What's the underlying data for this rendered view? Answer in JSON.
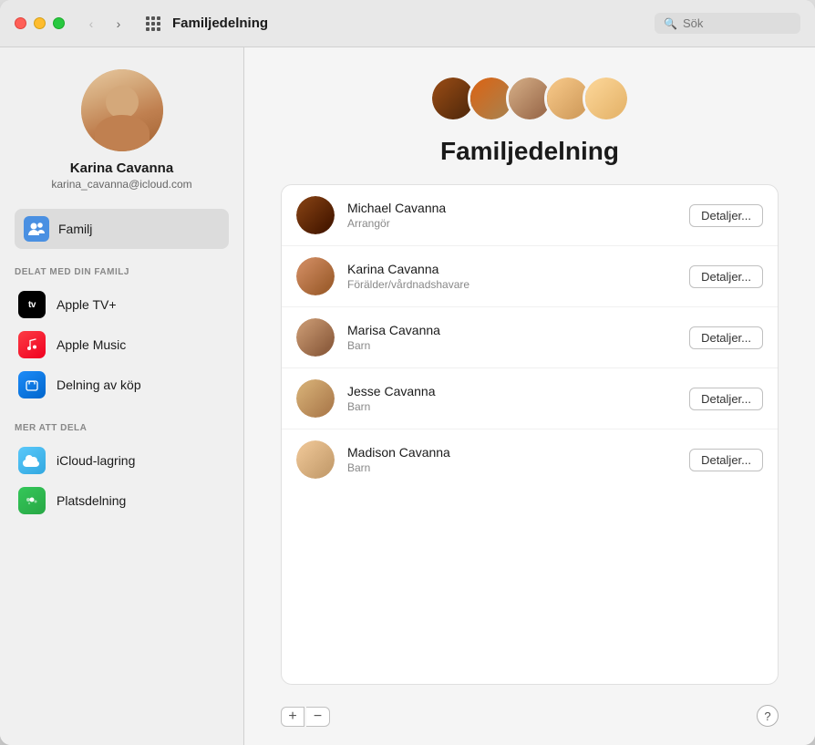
{
  "window": {
    "title": "Familjedelning",
    "search_placeholder": "Sök"
  },
  "traffic_lights": {
    "close": "close",
    "minimize": "minimize",
    "maximize": "maximize"
  },
  "sidebar": {
    "profile": {
      "name": "Karina Cavanna",
      "email": "karina_cavanna@icloud.com"
    },
    "family_nav": {
      "label": "Familj"
    },
    "shared_section_header": "DELAT MED DIN FAMILJ",
    "shared_items": [
      {
        "id": "appletv",
        "label": "Apple TV+"
      },
      {
        "id": "applemusic",
        "label": "Apple Music"
      },
      {
        "id": "purchases",
        "label": "Delning av köp"
      }
    ],
    "more_section_header": "MER ATT DELA",
    "more_items": [
      {
        "id": "icloud",
        "label": "iCloud-lagring"
      },
      {
        "id": "location",
        "label": "Platsdelning"
      }
    ]
  },
  "main": {
    "page_title": "Familjedelning",
    "members": [
      {
        "name": "Michael Cavanna",
        "role": "Arrangör",
        "btn_label": "Detaljer..."
      },
      {
        "name": "Karina Cavanna",
        "role": "Förälder/vårdnadshavare",
        "btn_label": "Detaljer..."
      },
      {
        "name": "Marisa Cavanna",
        "role": "Barn",
        "btn_label": "Detaljer..."
      },
      {
        "name": "Jesse Cavanna",
        "role": "Barn",
        "btn_label": "Detaljer..."
      },
      {
        "name": "Madison Cavanna",
        "role": "Barn",
        "btn_label": "Detaljer..."
      }
    ],
    "add_label": "+",
    "remove_label": "−",
    "help_label": "?"
  }
}
